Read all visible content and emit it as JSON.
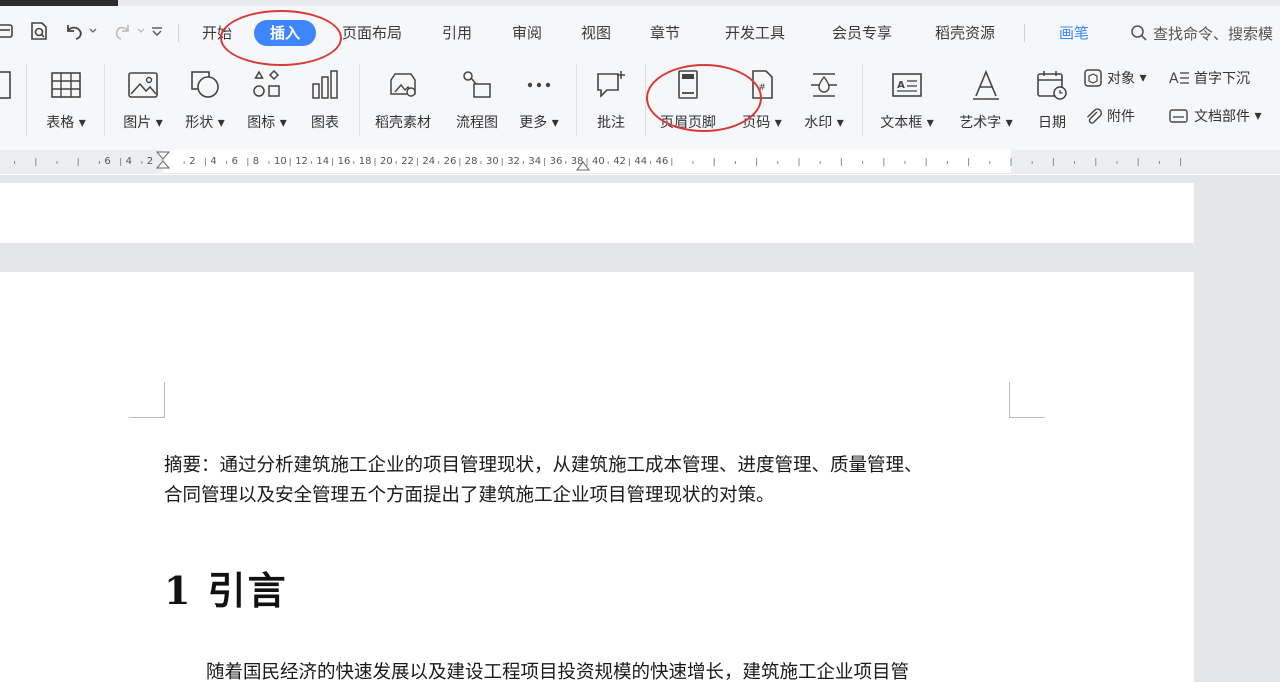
{
  "tabs": [
    {
      "label": "开始"
    },
    {
      "label": "插入"
    },
    {
      "label": "页面布局"
    },
    {
      "label": "引用"
    },
    {
      "label": "审阅"
    },
    {
      "label": "视图"
    },
    {
      "label": "章节"
    },
    {
      "label": "开发工具"
    },
    {
      "label": "会员专享"
    },
    {
      "label": "稻壳资源"
    },
    {
      "label": "画笔"
    }
  ],
  "search": {
    "placeholder": "查找命令、搜索模"
  },
  "ribbon": {
    "table": "表格",
    "picture": "图片",
    "shape": "形状",
    "icon": "图标",
    "chart": "图表",
    "material": "稻壳素材",
    "flowchart": "流程图",
    "more": "更多",
    "comment": "批注",
    "header_footer": "页眉页脚",
    "page_number": "页码",
    "watermark": "水印",
    "textbox": "文本框",
    "wordart": "艺术字",
    "date": "日期",
    "object": "对象",
    "attachment": "附件",
    "dropcap": "首字下沉",
    "doc_parts": "文档部件"
  },
  "ruler_labels": [
    "6",
    "4",
    "2",
    "2",
    "4",
    "6",
    "8",
    "10",
    "12",
    "14",
    "16",
    "18",
    "20",
    "22",
    "24",
    "26",
    "28",
    "30",
    "32",
    "34",
    "36",
    "38",
    "40",
    "42",
    "44",
    "46"
  ],
  "document": {
    "abstract_line1": "摘要：通过分析建筑施工企业的项目管理现状，从建筑施工成本管理、进度管理、质量管理、",
    "abstract_line2": "合同管理以及安全管理五个方面提出了建筑施工企业项目管理现状的对策。",
    "heading": "1 引言",
    "para_line1": "随着国民经济的快速发展以及建设工程项目投资规模的快速增长，建筑施工企业项目管"
  },
  "colors": {
    "accent": "#3e86ff",
    "annotation": "#d83a3a"
  }
}
